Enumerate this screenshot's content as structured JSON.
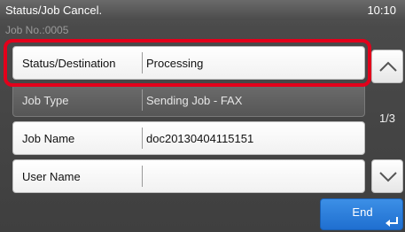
{
  "header": {
    "title": "Status/Job Cancel.",
    "clock": "10:10",
    "job_no": "Job No.:0005"
  },
  "rows": [
    {
      "label": "Status/Destination",
      "value": "Processing",
      "selected": true
    },
    {
      "label": "Job Type",
      "value": "Sending Job - FAX",
      "selected": false
    },
    {
      "label": "Job Name",
      "value": "doc20130404115151",
      "selected": false
    },
    {
      "label": "User Name",
      "value": "",
      "selected": false
    }
  ],
  "pager": {
    "text": "1/3"
  },
  "actions": {
    "end_label": "End"
  },
  "icons": {
    "scroll_up": "chevron-up-icon",
    "scroll_down": "chevron-down-icon",
    "end_enter": "enter-icon"
  },
  "colors": {
    "highlight": "#e3001b",
    "end_button": "#2a7fe0"
  }
}
